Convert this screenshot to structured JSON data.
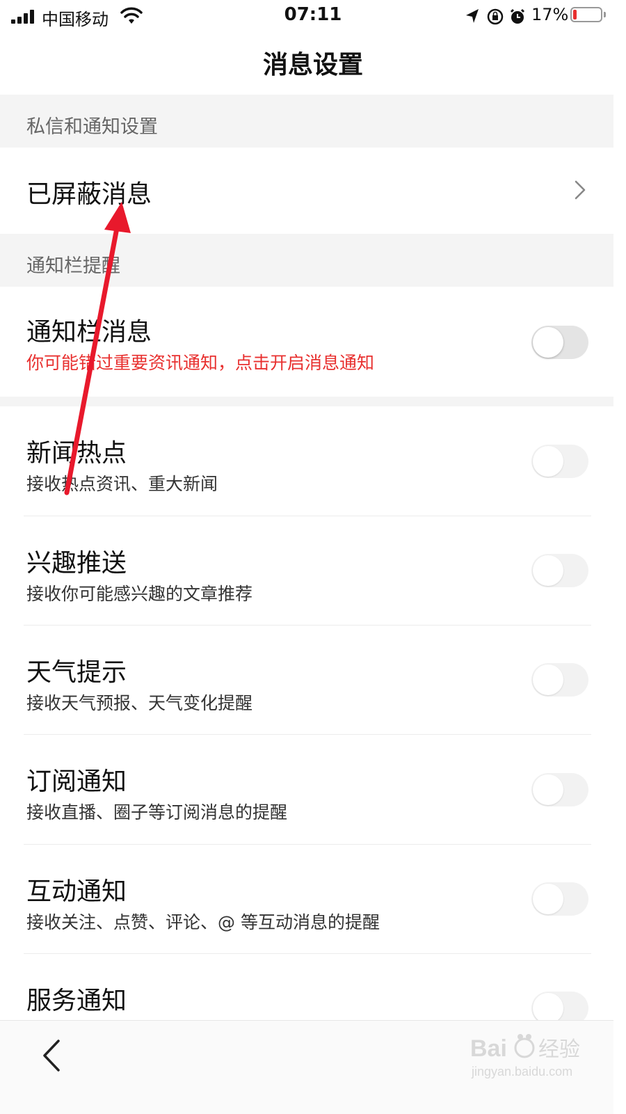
{
  "status_bar": {
    "carrier": "中国移动",
    "time": "07:11",
    "battery_percent": "17%",
    "battery_level": 0.17
  },
  "nav": {
    "title": "消息设置",
    "back_icon": "chevron-left-icon"
  },
  "sections": {
    "private": {
      "header": "私信和通知设置",
      "blocked": {
        "title": "已屏蔽消息",
        "icon": "chevron-right-icon"
      }
    },
    "notification_bar": {
      "header": "通知栏提醒",
      "bar_message": {
        "title": "通知栏消息",
        "warning": "你可能错过重要资讯通知，点击开启消息通知",
        "enabled": false
      }
    }
  },
  "items": [
    {
      "title": "新闻热点",
      "subtitle": "接收热点资讯、重大新闻",
      "enabled": false
    },
    {
      "title": "兴趣推送",
      "subtitle": "接收你可能感兴趣的文章推荐",
      "enabled": false
    },
    {
      "title": "天气提示",
      "subtitle": "接收天气预报、天气变化提醒",
      "enabled": false
    },
    {
      "title": "订阅通知",
      "subtitle": "接收直播、圈子等订阅消息的提醒",
      "enabled": false
    },
    {
      "title": "互动通知",
      "subtitle": "接收关注、点赞、评论、@ 等互动消息的提醒",
      "enabled": false
    },
    {
      "title": "服务通知",
      "subtitle": "",
      "enabled": false
    }
  ],
  "watermark": {
    "brand": "Bai 经验",
    "url": "jingyan.baidu.com"
  },
  "colors": {
    "accent_red": "#e8302f",
    "section_bg": "#f4f4f4",
    "toggle_off": "#eaeaea"
  }
}
